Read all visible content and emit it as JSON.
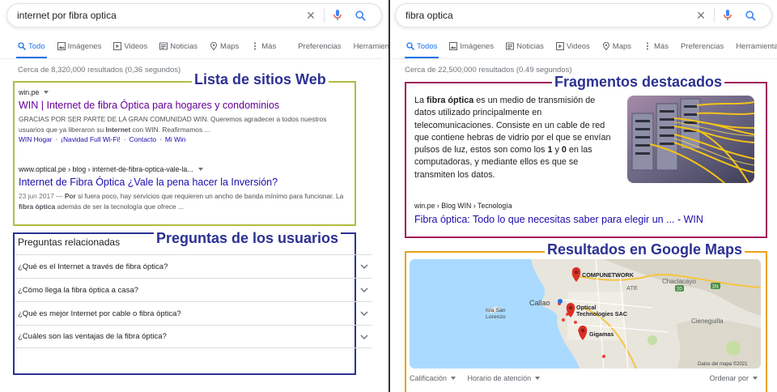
{
  "colors": {
    "lista_box": "#b0bc42",
    "preguntas_box": "#2c3192",
    "fragmentos_box": "#a3195b",
    "maps_box": "#e8a215",
    "link_blue": "#1a0dab",
    "visited": "#660099",
    "tab_active": "#1a73e8"
  },
  "left": {
    "search": {
      "query": "internet por fibra optica"
    },
    "tabs": [
      {
        "label": "Todo",
        "icon": "search-icon"
      },
      {
        "label": "Imágenes",
        "icon": "image-icon"
      },
      {
        "label": "Videos",
        "icon": "video-icon"
      },
      {
        "label": "Noticias",
        "icon": "news-icon"
      },
      {
        "label": "Maps",
        "icon": "map-pin-icon"
      },
      {
        "label": "Más",
        "icon": "more-vertical-icon"
      }
    ],
    "settings_tabs": [
      "Preferencias",
      "Herramientas"
    ],
    "stats": "Cerca de 8,320,000 resultados (0,36 segundos)",
    "annotations": {
      "lista": "Lista de sitios Web",
      "preguntas": "Preguntas de los usuarios"
    },
    "results": [
      {
        "url": "win.pe",
        "title": "WIN | Internet de fibra Óptica para hogares y condominios",
        "snippet_parts": [
          "GRACIAS POR SER PARTE DE LA GRAN COMUNIDAD WIN. Queremos agradecer a todos nuestros usuarios que ya liberaron su ",
          "Internet",
          " con WIN. Reafirmamos ..."
        ],
        "sitelinks": [
          "WIN Hogar",
          "·",
          "¡Navidad Full Wi-Fi!",
          "·",
          "Contacto",
          "·",
          "Mi Win"
        ]
      },
      {
        "url": "www.optical.pe › blog › internet-de-fibra-optica-vale-la...",
        "title": "Internet de Fibra Óptica ¿Vale la pena hacer la Inversión?",
        "date": "23 jun 2017 — ",
        "snippet_parts": [
          "Por",
          " si fuera poco, hay servicios que requieren un ancho de banda mínimo para funcionar. La ",
          "fibra óptica",
          " además de ser la tecnología que ofrece ..."
        ]
      }
    ],
    "paa": {
      "title": "Preguntas relacionadas",
      "questions": [
        "¿Qué es el Internet a través de fibra óptica?",
        "¿Cómo llega la fibra óptica a casa?",
        "¿Qué es mejor Internet por cable o fibra óptica?",
        "¿Cuáles son las ventajas de la fibra óptica?"
      ]
    }
  },
  "right": {
    "search": {
      "query": "fibra optica"
    },
    "tabs": [
      {
        "label": "Todos",
        "icon": "search-icon"
      },
      {
        "label": "Imágenes",
        "icon": "image-icon"
      },
      {
        "label": "Noticias",
        "icon": "news-icon"
      },
      {
        "label": "Videos",
        "icon": "video-icon"
      },
      {
        "label": "Maps",
        "icon": "map-pin-icon"
      },
      {
        "label": "Más",
        "icon": "more-vertical-icon"
      }
    ],
    "settings_tabs": [
      "Preferencias",
      "Herramientas"
    ],
    "stats": "Cerca de 22,500,000 resultados (0.49 segundos)",
    "annotations": {
      "fragmentos": "Fragmentos destacados",
      "maps": "Resultados en Google Maps"
    },
    "featured": {
      "text_parts": [
        "La ",
        "fibra óptica",
        " es un medio de transmisión de datos utilizado principalmente en telecomunicaciones. Consiste en un cable de red que contiene hebras de vidrio por el que se envían pulsos de luz, estos son como los ",
        "1",
        " y ",
        "0",
        " en las computadoras, y mediante ellos es que se transmiten los datos."
      ],
      "source": "win.pe › Blog WIN › Tecnología",
      "link": "Fibra óptica: Todo lo que necesitas saber para elegir un ... - WIN"
    },
    "map": {
      "places": [
        "COMPUNETWORK",
        "Optical Technologies SAC",
        "Gigamas"
      ],
      "labels": [
        "Chaclacayo",
        "ATE",
        "Callao",
        "Isla San Lorenzo",
        "Cieneguilla"
      ],
      "road_labels": [
        "20",
        "1N"
      ],
      "attribution": "Datos del mapa ©2021",
      "filters": [
        "Calificación",
        "Horario de atención"
      ],
      "sort": "Ordenar por"
    }
  }
}
